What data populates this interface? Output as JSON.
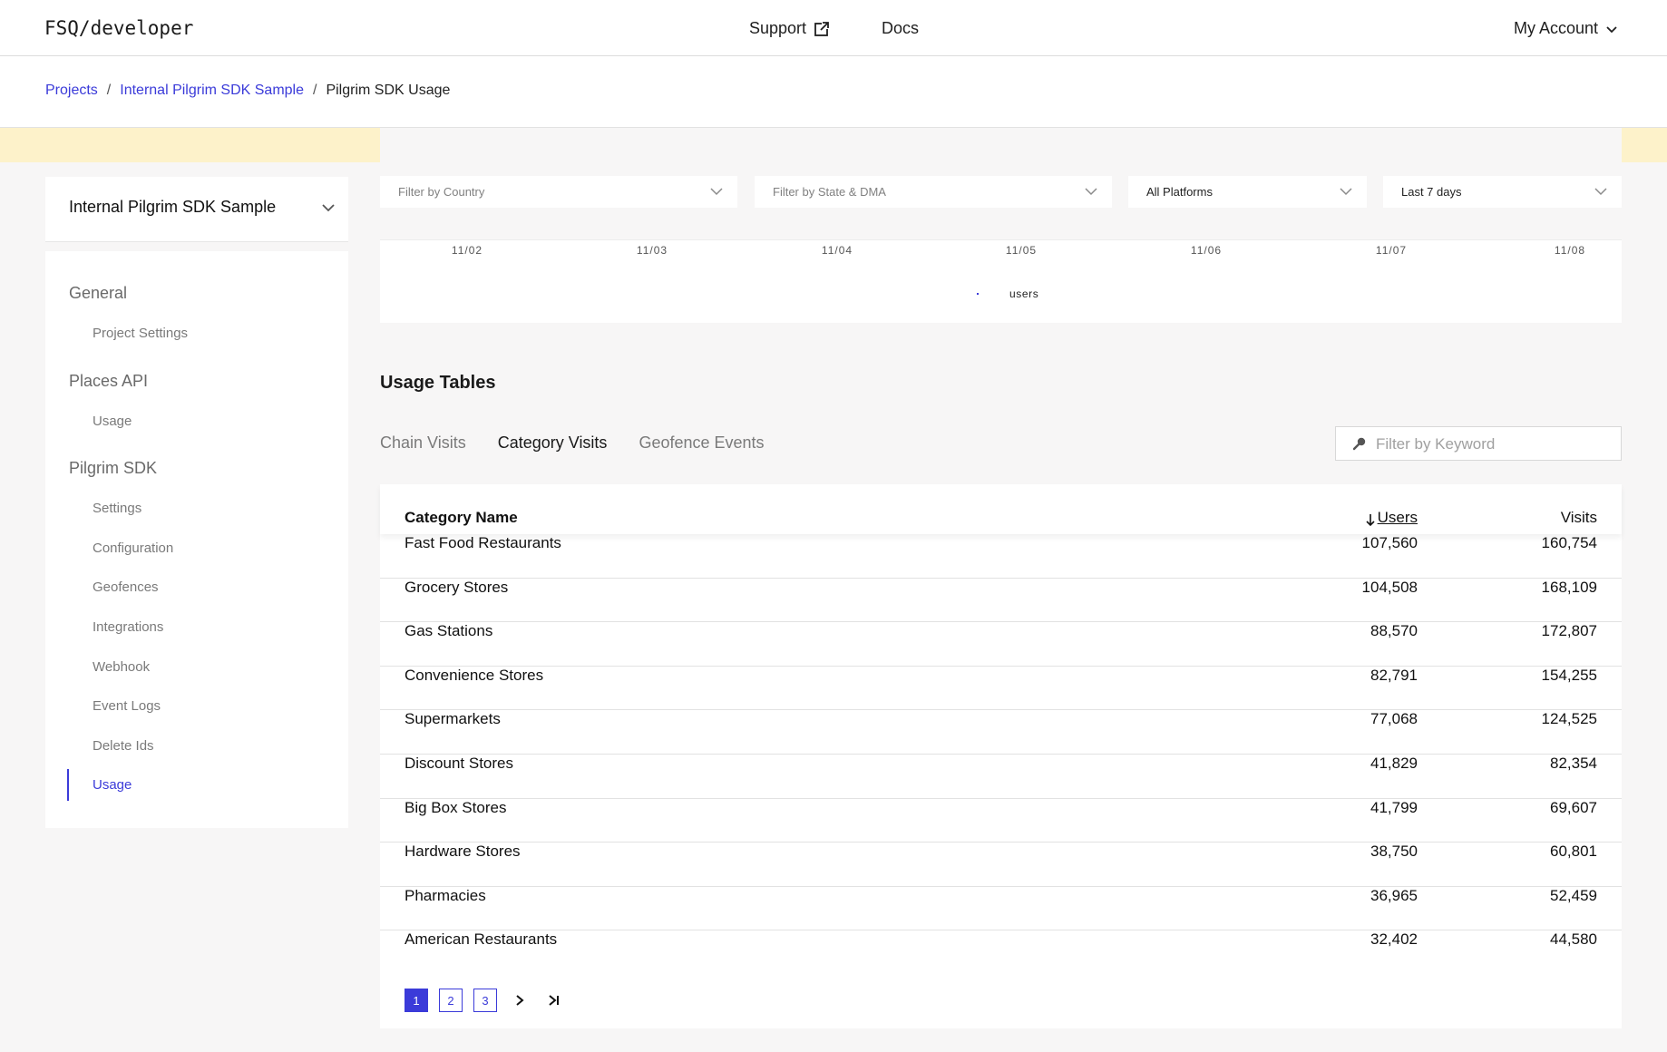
{
  "header": {
    "logo": "FSQ/developer",
    "support_label": "Support",
    "docs_label": "Docs",
    "account_label": "My Account"
  },
  "breadcrumb": {
    "items": [
      "Projects",
      "Internal Pilgrim SDK Sample"
    ],
    "current": "Pilgrim SDK Usage"
  },
  "sidebar": {
    "project": "Internal Pilgrim SDK Sample",
    "sections": [
      {
        "title": "General",
        "items": [
          "Project Settings"
        ]
      },
      {
        "title": "Places API",
        "items": [
          "Usage"
        ]
      },
      {
        "title": "Pilgrim SDK",
        "items": [
          "Settings",
          "Configuration",
          "Geofences",
          "Integrations",
          "Webhook",
          "Event Logs",
          "Delete Ids",
          "Usage"
        ]
      }
    ],
    "active_item": "Usage"
  },
  "filters": {
    "country_placeholder": "Filter by Country",
    "state_placeholder": "Filter by State & DMA",
    "platform_value": "All Platforms",
    "period_value": "Last 7 days"
  },
  "chart": {
    "ticks": [
      "11/02",
      "11/03",
      "11/04",
      "11/05",
      "11/06",
      "11/07",
      "11/08"
    ],
    "legend": "users",
    "series_color": "#3b3bd9"
  },
  "usage": {
    "title": "Usage Tables",
    "tabs": [
      "Chain Visits",
      "Category Visits",
      "Geofence Events"
    ],
    "active_tab": "Category Visits",
    "search_placeholder": "Filter by Keyword",
    "columns": {
      "name": "Category Name",
      "users": "Users",
      "visits": "Visits"
    },
    "sort": {
      "column": "Users",
      "direction": "descending"
    },
    "rows": [
      {
        "name": "Fast Food Restaurants",
        "users": "107,560",
        "visits": "160,754"
      },
      {
        "name": "Grocery Stores",
        "users": "104,508",
        "visits": "168,109"
      },
      {
        "name": "Gas Stations",
        "users": "88,570",
        "visits": "172,807"
      },
      {
        "name": "Convenience Stores",
        "users": "82,791",
        "visits": "154,255"
      },
      {
        "name": "Supermarkets",
        "users": "77,068",
        "visits": "124,525"
      },
      {
        "name": "Discount Stores",
        "users": "41,829",
        "visits": "82,354"
      },
      {
        "name": "Big Box Stores",
        "users": "41,799",
        "visits": "69,607"
      },
      {
        "name": "Hardware Stores",
        "users": "38,750",
        "visits": "60,801"
      },
      {
        "name": "Pharmacies",
        "users": "36,965",
        "visits": "52,459"
      },
      {
        "name": "American Restaurants",
        "users": "32,402",
        "visits": "44,580"
      }
    ],
    "pages": [
      "1",
      "2",
      "3"
    ],
    "current_page": "1"
  },
  "colors": {
    "accent": "#3b3bd9",
    "banner": "#fdf2ca",
    "background": "#f7f6f6"
  }
}
